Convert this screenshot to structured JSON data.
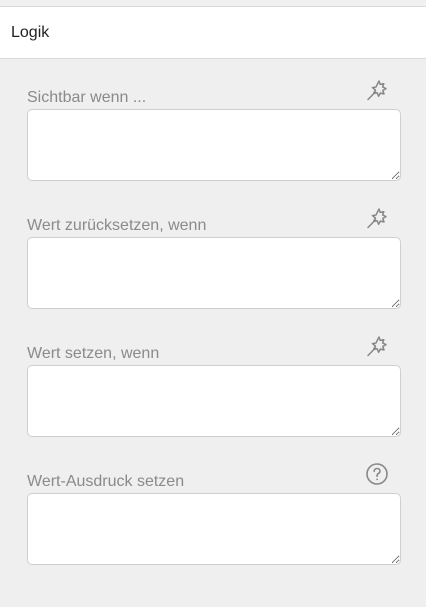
{
  "panel": {
    "title": "Logik"
  },
  "fields": [
    {
      "label": "Sichtbar wenn ...",
      "icon": "wand-icon",
      "value": ""
    },
    {
      "label": "Wert zurücksetzen, wenn",
      "icon": "wand-icon",
      "value": ""
    },
    {
      "label": "Wert setzen, wenn",
      "icon": "wand-icon",
      "value": ""
    },
    {
      "label": "Wert-Ausdruck setzen",
      "icon": "help-icon",
      "value": ""
    }
  ],
  "colors": {
    "background": "#efefef",
    "label": "#8a8a8a",
    "icon": "#888888",
    "input_border": "#cfcfcf"
  }
}
